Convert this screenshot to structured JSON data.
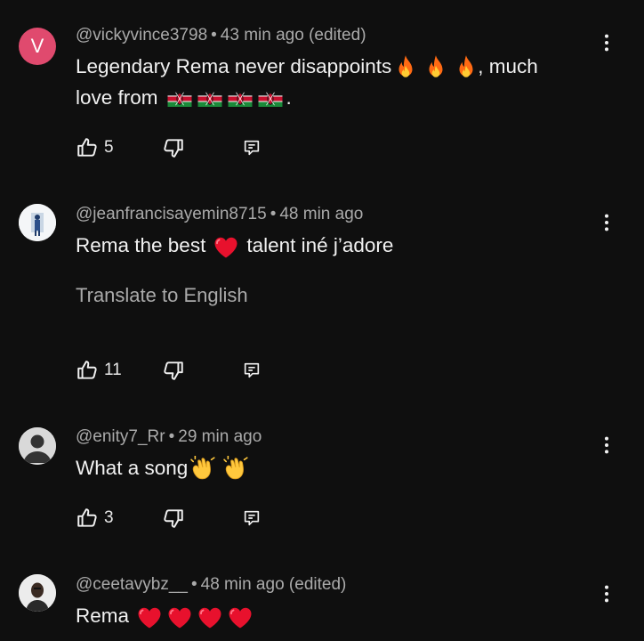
{
  "comments": [
    {
      "handle": "@vickyvince3798",
      "time": "43 min ago",
      "edited": "(edited)",
      "avatar_letter": "V",
      "line1": "Legendary Rema  never disappoints",
      "line1_suffix": ", much",
      "line2": "love from",
      "line2_suffix": ".",
      "likes": "5"
    },
    {
      "handle": "@jeanfrancisayemin8715",
      "time": "48 min ago",
      "line1_a": "Rema the best",
      "line1_b": "talent iné j’adore",
      "translate": "Translate to English",
      "likes": "11"
    },
    {
      "handle": "@enity7_Rr",
      "time": "29 min ago",
      "line1": "What a song",
      "likes": "3"
    },
    {
      "handle": "@ceetavybz__",
      "time": "48 min ago",
      "edited": "(edited)",
      "line1": "Rema"
    }
  ],
  "separator": "•",
  "icons": {
    "like": "thumbs-up-icon",
    "dislike": "thumbs-down-icon",
    "reply": "reply-icon",
    "more": "more-vertical-icon",
    "fire": "fire-emoji",
    "flag": "kenya-flag-emoji",
    "heart": "red-heart-emoji",
    "clap": "clapping-hands-emoji"
  },
  "colors": {
    "background": "#0f0f0f",
    "text": "#f1f1f1",
    "secondary": "#aaaaaa",
    "avatar_v": "#e04a6e"
  }
}
